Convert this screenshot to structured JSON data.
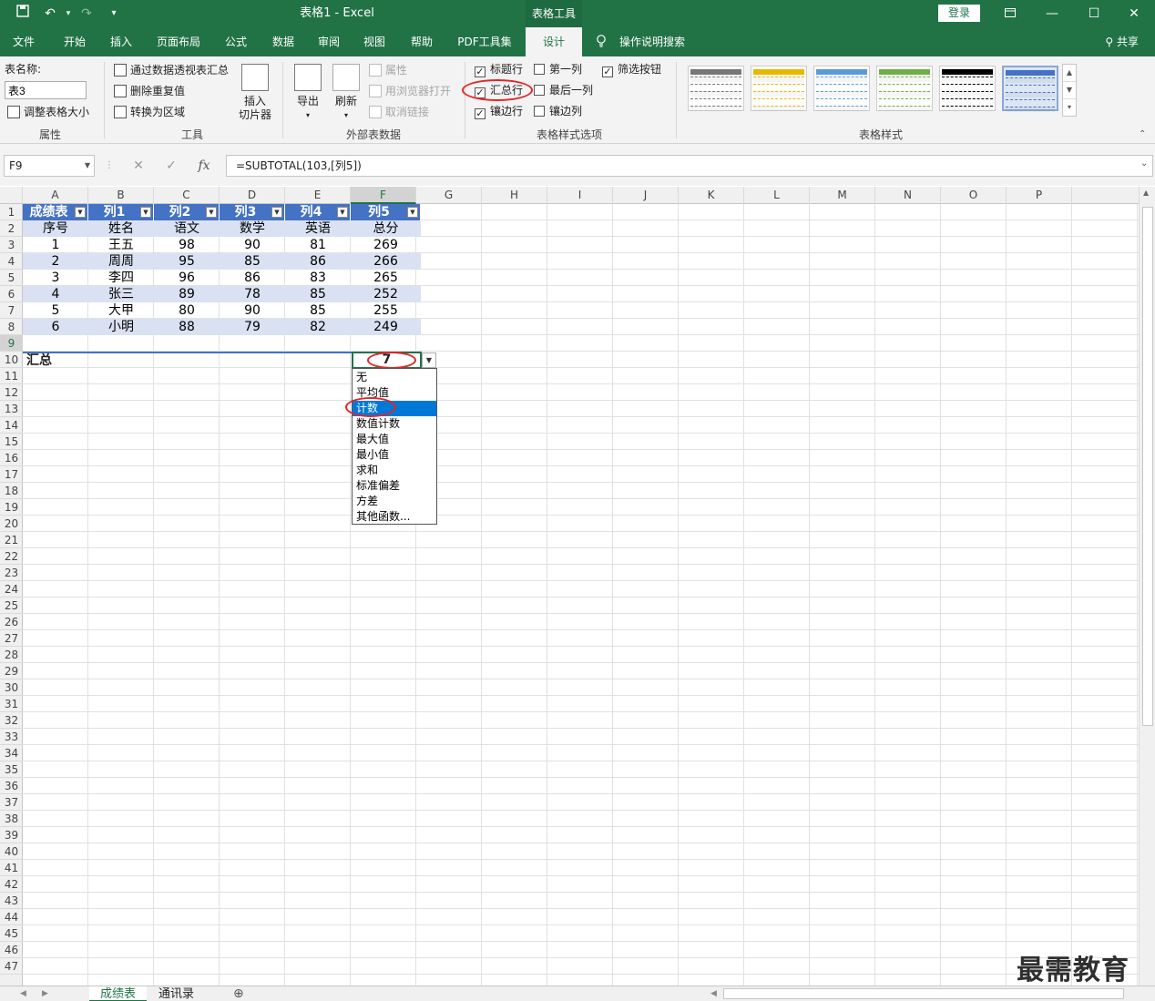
{
  "titlebar": {
    "title": "表格1 - Excel",
    "context_tab": "表格工具",
    "login": "登录"
  },
  "tabs": [
    "文件",
    "开始",
    "插入",
    "页面布局",
    "公式",
    "数据",
    "审阅",
    "视图",
    "帮助",
    "PDF工具集",
    "设计",
    "操作说明搜索"
  ],
  "active_tab": "设计",
  "share": "共享",
  "ribbon": {
    "props": {
      "label": "表名称:",
      "name_value": "表3",
      "resize": "调整表格大小",
      "group": "属性"
    },
    "tools": {
      "pivot": "通过数据透视表汇总",
      "dedupe": "删除重复值",
      "convert": "转换为区域",
      "slicer_line1": "插入",
      "slicer_line2": "切片器",
      "group": "工具"
    },
    "external": {
      "export": "导出",
      "refresh": "刷新",
      "properties": "属性",
      "open_browser": "用浏览器打开",
      "unlink": "取消链接",
      "group": "外部表数据"
    },
    "options": {
      "header_row": "标题行",
      "total_row": "汇总行",
      "banded_rows": "镶边行",
      "first_col": "第一列",
      "last_col": "最后一列",
      "banded_cols": "镶边列",
      "filter_btn": "筛选按钮",
      "group": "表格样式选项",
      "checked": {
        "header_row": true,
        "total_row": true,
        "banded_rows": true,
        "first_col": false,
        "last_col": false,
        "banded_cols": false,
        "filter_btn": true
      }
    },
    "styles": {
      "group": "表格样式",
      "colors": [
        "#777777",
        "#e6b800",
        "#5b9bd5",
        "#70ad47",
        "#000000",
        "#4472c4"
      ]
    }
  },
  "formula_bar": {
    "name_box": "F9",
    "formula": "=SUBTOTAL(103,[列5])"
  },
  "columns": [
    "A",
    "B",
    "C",
    "D",
    "E",
    "F",
    "G",
    "H",
    "I",
    "J",
    "K",
    "L",
    "M",
    "N",
    "O",
    "P"
  ],
  "table": {
    "headers": [
      "成绩表",
      "列1",
      "列2",
      "列3",
      "列4",
      "列5"
    ],
    "rows": [
      [
        "序号",
        "姓名",
        "语文",
        "数学",
        "英语",
        "总分"
      ],
      [
        "1",
        "王五",
        "98",
        "90",
        "81",
        "269"
      ],
      [
        "2",
        "周周",
        "95",
        "85",
        "86",
        "266"
      ],
      [
        "3",
        "李四",
        "96",
        "86",
        "83",
        "265"
      ],
      [
        "4",
        "张三",
        "89",
        "78",
        "85",
        "252"
      ],
      [
        "5",
        "大甲",
        "80",
        "90",
        "85",
        "255"
      ],
      [
        "6",
        "小明",
        "88",
        "79",
        "82",
        "249"
      ]
    ],
    "total_label": "汇总",
    "total_value": "7"
  },
  "dropdown": {
    "items": [
      "无",
      "平均值",
      "计数",
      "数值计数",
      "最大值",
      "最小值",
      "求和",
      "标准偏差",
      "方差",
      "其他函数..."
    ],
    "selected": "计数"
  },
  "sheets": [
    "成绩表",
    "通讯录"
  ],
  "active_sheet": "成绩表",
  "watermark": "最需教育",
  "accent": "#217346",
  "table_header_color": "#4472c4",
  "band_color": "#d9e1f2"
}
